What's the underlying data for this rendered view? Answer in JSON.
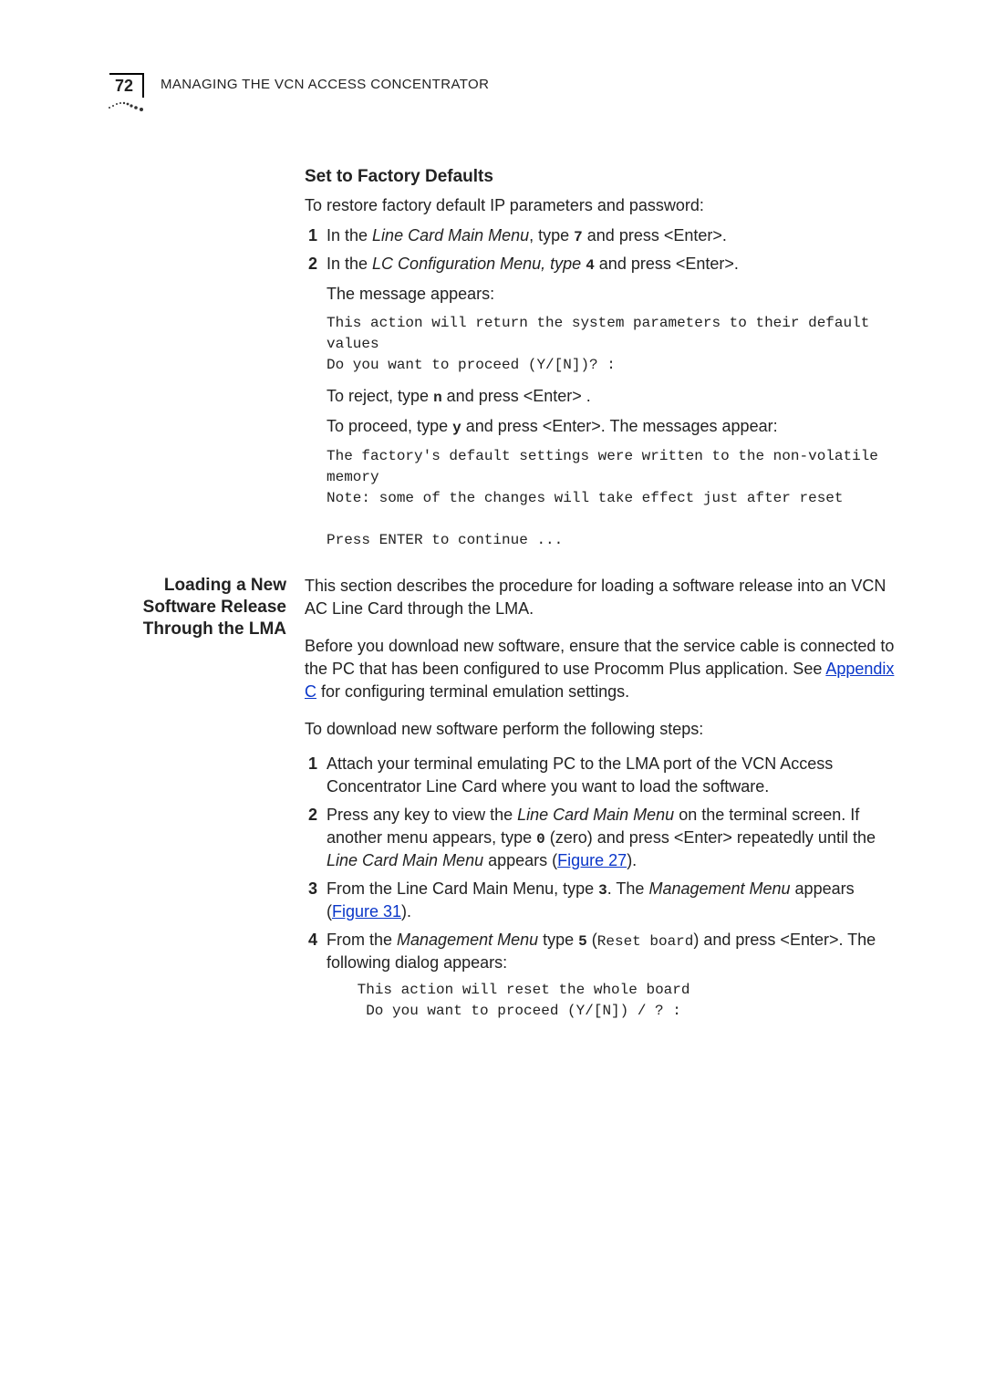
{
  "page_number": "72",
  "running_head_1": "M",
  "running_head_2": "ANAGING",
  "running_head_3": " THE ",
  "running_head_4": "VCN A",
  "running_head_5": "CCESS",
  "running_head_6": " C",
  "running_head_7": "ONCENTRATOR",
  "sec1_title": "Set to Factory Defaults",
  "sec1_p1": "To restore factory default IP parameters and password:",
  "sec1_s1_a": "In the ",
  "sec1_s1_menu": "Line Card Main Menu",
  "sec1_s1_b": ", type ",
  "sec1_s1_key": "7",
  "sec1_s1_c": " and press <Enter>.",
  "sec1_s2_a": "In the ",
  "sec1_s2_menu": "LC Configuration Menu, type ",
  "sec1_s2_key": "4",
  "sec1_s2_c": " and press <Enter>.",
  "sec1_msg_label": "The message appears:",
  "sec1_code1": "This action will return the system parameters to their default values\nDo you want to proceed (Y/[N])? :",
  "sec1_reject_a": "To reject, type ",
  "sec1_reject_key": "n",
  "sec1_reject_b": " and press <Enter> .",
  "sec1_proceed_a": "To proceed, type ",
  "sec1_proceed_key": "y",
  "sec1_proceed_b": " and press <Enter>. The messages appear:",
  "sec1_code2": "The factory's default settings were written to the non-volatile memory\nNote: some of the changes will take effect just after reset\n\nPress ENTER to continue ...",
  "side_l1": "Loading a New",
  "side_l2": "Software Release",
  "side_l3": "Through the LMA",
  "sec2_p1": "This section describes the procedure for loading a software release into an VCN AC Line Card through the LMA.",
  "sec2_p2_a": "Before you download new software, ensure that the service cable is connected to the PC that has been configured to use Procomm Plus application. See ",
  "sec2_p2_link": "Appendix C",
  "sec2_p2_b": " for configuring terminal emulation settings.",
  "sec2_p3": "To download new software perform the following steps:",
  "sec2_s1": "Attach your terminal emulating PC to the LMA port of the VCN Access Concentrator Line Card where you want to load the software.",
  "sec2_s2_a": "Press any key to view the ",
  "sec2_s2_menu": "Line Card Main Menu",
  "sec2_s2_b": " on the terminal screen. If another menu appears, type ",
  "sec2_s2_key": "0",
  "sec2_s2_c": " (zero) and press <Enter> repeatedly until the ",
  "sec2_s2_menu2": "Line Card Main Menu",
  "sec2_s2_d": " appears (",
  "sec2_s2_link": "Figure 27",
  "sec2_s2_e": ").",
  "sec2_s3_a": "From the Line Card Main Menu, type ",
  "sec2_s3_key": "3",
  "sec2_s3_b": ". The ",
  "sec2_s3_menu": "Management Menu",
  "sec2_s3_c": " appears (",
  "sec2_s3_link": "Figure 31",
  "sec2_s3_d": ").",
  "sec2_s4_a": "From the ",
  "sec2_s4_menu": "Management Menu",
  "sec2_s4_b": " type ",
  "sec2_s4_key": "5",
  "sec2_s4_c": " (",
  "sec2_s4_code": "Reset board",
  "sec2_s4_d": ") and press <Enter>. The following dialog appears:",
  "sec2_code": " This action will reset the whole board\n  Do you want to proceed (Y/[N]) / ? :",
  "n1": "1",
  "n2": "2",
  "n3": "3",
  "n4": "4"
}
